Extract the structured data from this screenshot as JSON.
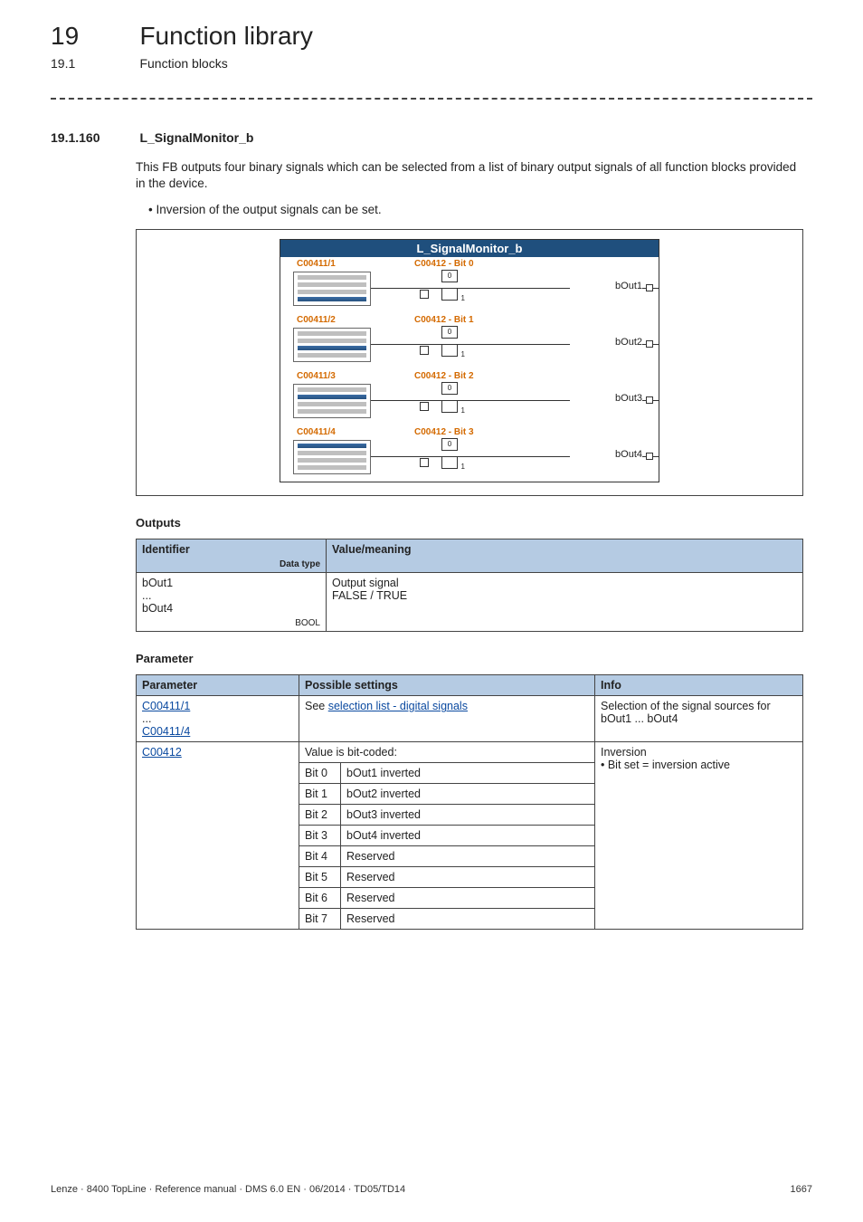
{
  "header": {
    "chapter_num": "19",
    "chapter_title": "Function library",
    "section_num": "19.1",
    "section_title": "Function blocks"
  },
  "section": {
    "num": "19.1.160",
    "title": "L_SignalMonitor_b",
    "intro": "This FB outputs four binary signals which can be selected from a list of binary output signals of all function blocks provided in the device.",
    "bullet1": "Inversion of the output signals can be set."
  },
  "diagram": {
    "title": "L_SignalMonitor_b",
    "rows": [
      {
        "src": "C00411/1",
        "inv": "C00412 - Bit 0",
        "out": "bOut1"
      },
      {
        "src": "C00411/2",
        "inv": "C00412 - Bit 1",
        "out": "bOut2"
      },
      {
        "src": "C00411/3",
        "inv": "C00412 - Bit 2",
        "out": "bOut3"
      },
      {
        "src": "C00411/4",
        "inv": "C00412 - Bit 3",
        "out": "bOut4"
      }
    ],
    "sw0": "0",
    "sw1": "1"
  },
  "outputs": {
    "heading": "Outputs",
    "th_identifier": "Identifier",
    "th_datatype": "Data type",
    "th_value": "Value/meaning",
    "row1_id": "bOut1\n...\nbOut4",
    "row1_type": "BOOL",
    "row1_val": "Output signal\nFALSE / TRUE"
  },
  "params": {
    "heading": "Parameter",
    "th_param": "Parameter",
    "th_settings": "Possible settings",
    "th_info": "Info",
    "r1_param_a": "C00411/1",
    "r1_param_mid": "...",
    "r1_param_b": "C00411/4",
    "r1_settings_prefix": "See ",
    "r1_settings_link": "selection list - digital signals",
    "r1_info": "Selection of the signal sources for bOut1 ... bOut4",
    "r2_param": "C00412",
    "r2_settings_head": "Value is bit-coded:",
    "r2_info_line1": "Inversion",
    "r2_info_line2": "• Bit set = inversion active",
    "bits": [
      {
        "bit": "Bit 0",
        "desc": "bOut1 inverted"
      },
      {
        "bit": "Bit 1",
        "desc": "bOut2 inverted"
      },
      {
        "bit": "Bit 2",
        "desc": "bOut3 inverted"
      },
      {
        "bit": "Bit 3",
        "desc": "bOut4 inverted"
      },
      {
        "bit": "Bit 4",
        "desc": "Reserved"
      },
      {
        "bit": "Bit 5",
        "desc": "Reserved"
      },
      {
        "bit": "Bit 6",
        "desc": "Reserved"
      },
      {
        "bit": "Bit 7",
        "desc": "Reserved"
      }
    ]
  },
  "footer": {
    "left": "Lenze · 8400 TopLine · Reference manual · DMS 6.0 EN · 06/2014 · TD05/TD14",
    "right": "1667"
  }
}
